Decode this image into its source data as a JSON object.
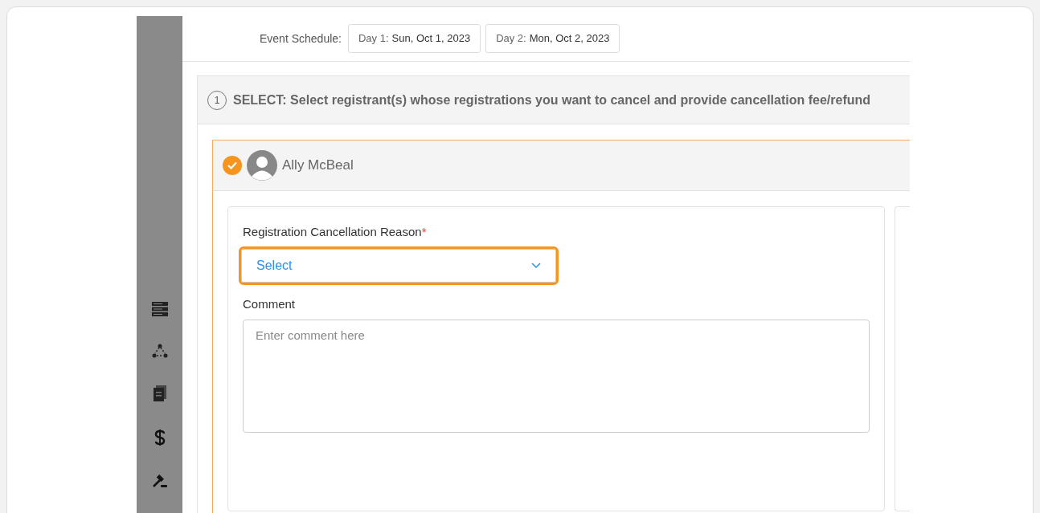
{
  "event_schedule": {
    "label": "Event Schedule:",
    "days": [
      {
        "prefix": "Day 1:",
        "date": "Sun, Oct 1, 2023"
      },
      {
        "prefix": "Day 2:",
        "date": "Mon, Oct 2, 2023"
      }
    ]
  },
  "sidebar": {
    "items": [
      {
        "kind": "server"
      },
      {
        "kind": "network"
      },
      {
        "kind": "document"
      },
      {
        "kind": "dollar"
      },
      {
        "kind": "gavel"
      }
    ]
  },
  "step": {
    "number": "1",
    "text": "SELECT: Select registrant(s) whose registrations you want to cancel and provide cancellation fee/refund"
  },
  "registrant": {
    "name": "Ally McBeal",
    "checked": true
  },
  "form": {
    "reason_label": "Registration Cancellation Reason",
    "required_mark": "*",
    "reason_value": "Select",
    "reason_focused": true,
    "comment_label": "Comment",
    "comment_placeholder": "Enter comment here"
  }
}
